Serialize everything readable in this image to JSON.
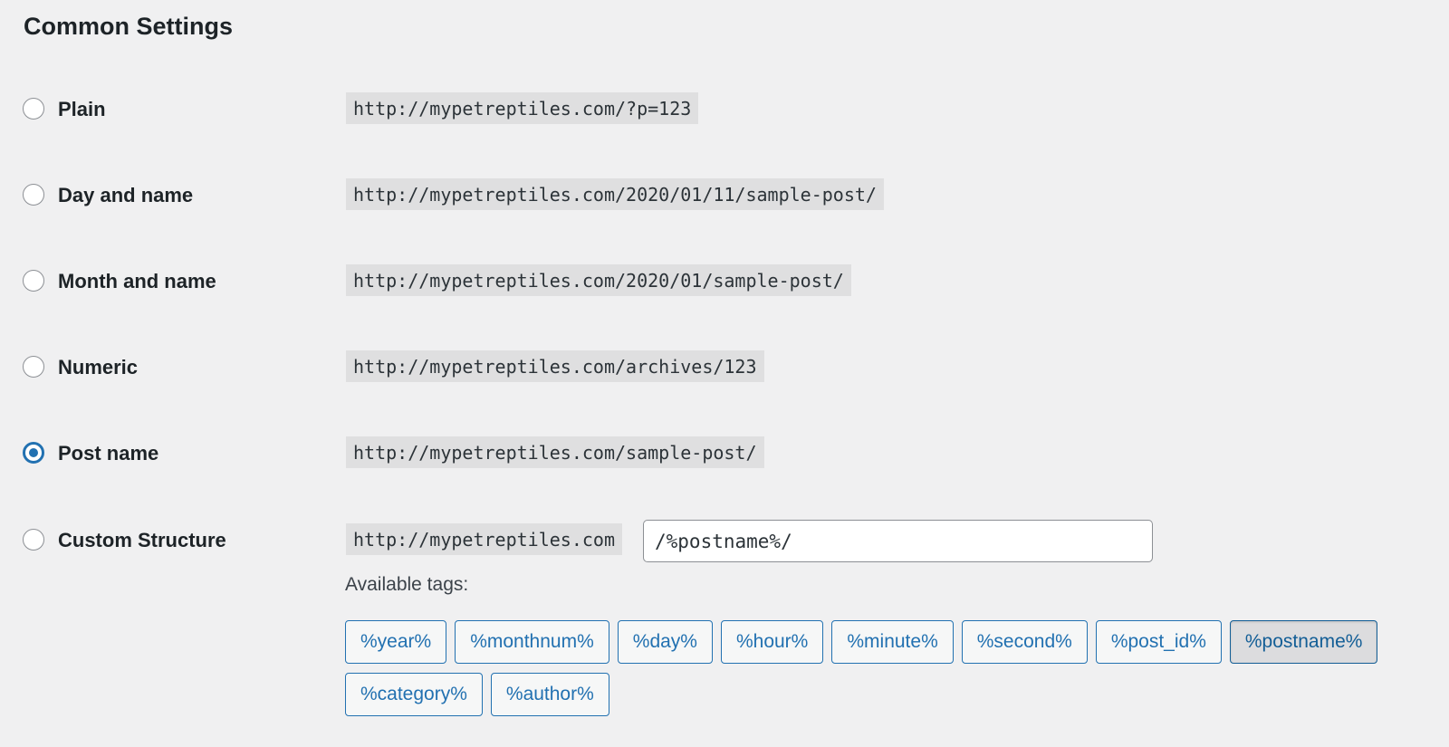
{
  "section_title": "Common Settings",
  "options": [
    {
      "label": "Plain",
      "example": "http://mypetreptiles.com/?p=123",
      "checked": false
    },
    {
      "label": "Day and name",
      "example": "http://mypetreptiles.com/2020/01/11/sample-post/",
      "checked": false
    },
    {
      "label": "Month and name",
      "example": "http://mypetreptiles.com/2020/01/sample-post/",
      "checked": false
    },
    {
      "label": "Numeric",
      "example": "http://mypetreptiles.com/archives/123",
      "checked": false
    },
    {
      "label": "Post name",
      "example": "http://mypetreptiles.com/sample-post/",
      "checked": true
    },
    {
      "label": "Custom Structure",
      "example": "http://mypetreptiles.com",
      "checked": false
    }
  ],
  "custom": {
    "value": "/%postname%/",
    "available_tags_label": "Available tags:",
    "tags": [
      "%year%",
      "%monthnum%",
      "%day%",
      "%hour%",
      "%minute%",
      "%second%",
      "%post_id%",
      "%postname%",
      "%category%",
      "%author%"
    ],
    "active_tag": "%postname%"
  },
  "colors": {
    "accent": "#2271b1",
    "background": "#f0f0f1"
  }
}
